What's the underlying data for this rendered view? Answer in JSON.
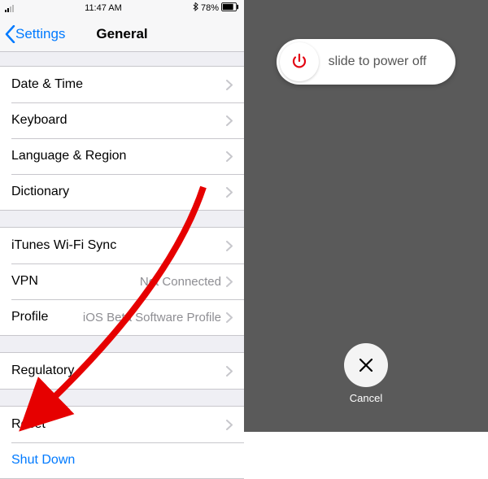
{
  "statusBar": {
    "time": "11:47 AM",
    "batteryPct": "78%"
  },
  "nav": {
    "back": "Settings",
    "title": "General"
  },
  "rows": {
    "dateTime": {
      "label": "Date & Time"
    },
    "keyboard": {
      "label": "Keyboard"
    },
    "langRegion": {
      "label": "Language & Region"
    },
    "dictionary": {
      "label": "Dictionary"
    },
    "itunesWifi": {
      "label": "iTunes Wi-Fi Sync"
    },
    "vpn": {
      "label": "VPN",
      "detail": "Not Connected"
    },
    "profile": {
      "label": "Profile",
      "detail": "iOS Beta Software Profile"
    },
    "regulatory": {
      "label": "Regulatory"
    },
    "reset": {
      "label": "Reset"
    },
    "shutDown": {
      "label": "Shut Down"
    }
  },
  "powerOff": {
    "sliderText": "slide to power off",
    "cancel": "Cancel"
  },
  "colors": {
    "iosBlue": "#007aff",
    "iosGray": "#8e8e93",
    "arrowRed": "#e60000",
    "powerRed": "#e30613"
  }
}
